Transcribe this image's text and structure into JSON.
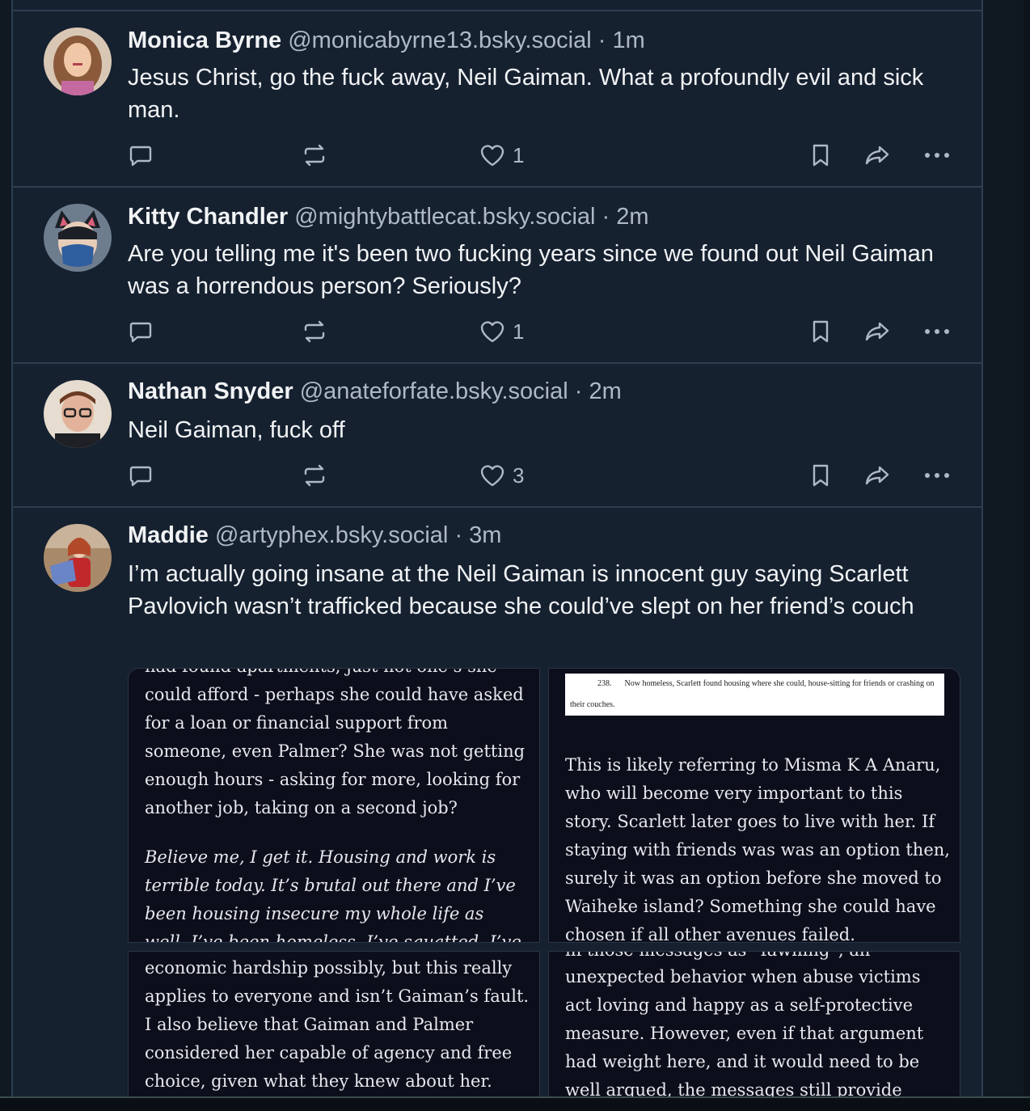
{
  "posts": [
    {
      "name": "Monica Byrne",
      "handle": "@monicabyrne13.bsky.social",
      "time": "1m",
      "text": "Jesus Christ, go the fuck away, Neil Gaiman. What a profoundly evil and sick man.",
      "likes": "1",
      "avatar_color": "#b78a63"
    },
    {
      "name": "Kitty Chandler",
      "handle": "@mightybattlecat.bsky.social",
      "time": "2m",
      "text": "Are you telling me it's been two fucking years since we found out Neil Gaiman was a horrendous person? Seriously?",
      "likes": "1",
      "avatar_color": "#4d5f77"
    },
    {
      "name": "Nathan Snyder",
      "handle": "@anateforfate.bsky.social",
      "time": "2m",
      "text": "Neil Gaiman, fuck off",
      "likes": "3",
      "avatar_color": "#c9a58e"
    },
    {
      "name": "Maddie",
      "handle": "@artyphex.bsky.social",
      "time": "3m",
      "text": "I’m actually going insane at the Neil Gaiman is innocent guy saying Scarlett Pavlovich wasn’t trafficked because she could’ve slept on her friend’s couch",
      "avatar_color": "#8a6a5a"
    }
  ],
  "separator": "·",
  "images": {
    "img1": {
      "clipped_top": "had found apartments, just not one’s she",
      "para": "could afford - perhaps she could have asked for a loan or financial support from someone, even Palmer? She was not getting enough hours - asking for more, looking for another job, taking on a second job?",
      "italic": "Believe me, I get it. Housing and work is terrible today. It’s brutal out there and I’ve been housing insecure my whole life as well, I’ve been homeless, I’ve squatted, I’ve lived in"
    },
    "img2": {
      "paper_num": "238.",
      "paper_text": "Now homeless, Scarlett found housing where she could, house-sitting for friends or crashing on their couches.",
      "para": "This is likely referring to Misma K A Anaru, who will become very important to this story. Scarlett later goes to live with her. If staying with friends was was an option then, surely it was an option before she moved to Waiheke island? Something she could have chosen if all other avenues failed."
    },
    "img3": {
      "para": "economic hardship possibly, but this really applies to everyone and isn’t Gaiman’s fault. I also believe that Gaiman and Palmer considered her capable of agency and free choice, given what they knew about her."
    },
    "img4": {
      "clipped_top": "in those messages as “fawning”, an",
      "para": "unexpected behavior when abuse victims act loving and happy as a self-protective measure. However, even if that argument had weight here, and it would need to be well argued, the messages still provide"
    }
  }
}
